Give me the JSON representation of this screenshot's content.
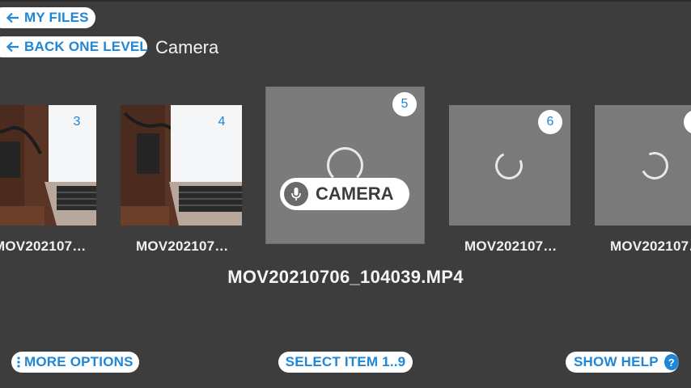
{
  "nav": {
    "my_files_label": "MY FILES",
    "back_label": "BACK ONE LEVEL",
    "folder_title": "Camera"
  },
  "carousel": {
    "items": [
      {
        "badge": "",
        "label": "MOV202107…",
        "kind": "photo"
      },
      {
        "badge": "3",
        "label": "MOV202107…",
        "kind": "photo"
      },
      {
        "badge": "4",
        "label": "MOV202107…",
        "kind": "photo"
      },
      {
        "badge": "5",
        "label": "",
        "kind": "loading",
        "selected": true
      },
      {
        "badge": "6",
        "label": "MOV202107…",
        "kind": "loading"
      },
      {
        "badge": "",
        "label": "MOV202107…",
        "kind": "loading"
      }
    ],
    "voice_prompt": "CAMERA"
  },
  "selected_filename": "MOV20210706_104039.MP4",
  "bottom_bar": {
    "more_options_label": "MORE OPTIONS",
    "select_item_label": "SELECT ITEM 1..9",
    "show_help_label": "SHOW HELP",
    "help_icon_glyph": "?"
  },
  "colors": {
    "background": "#3d3d3d",
    "accent": "#2086d6",
    "pill": "#ffffff",
    "placeholder": "#7a7a7a"
  }
}
